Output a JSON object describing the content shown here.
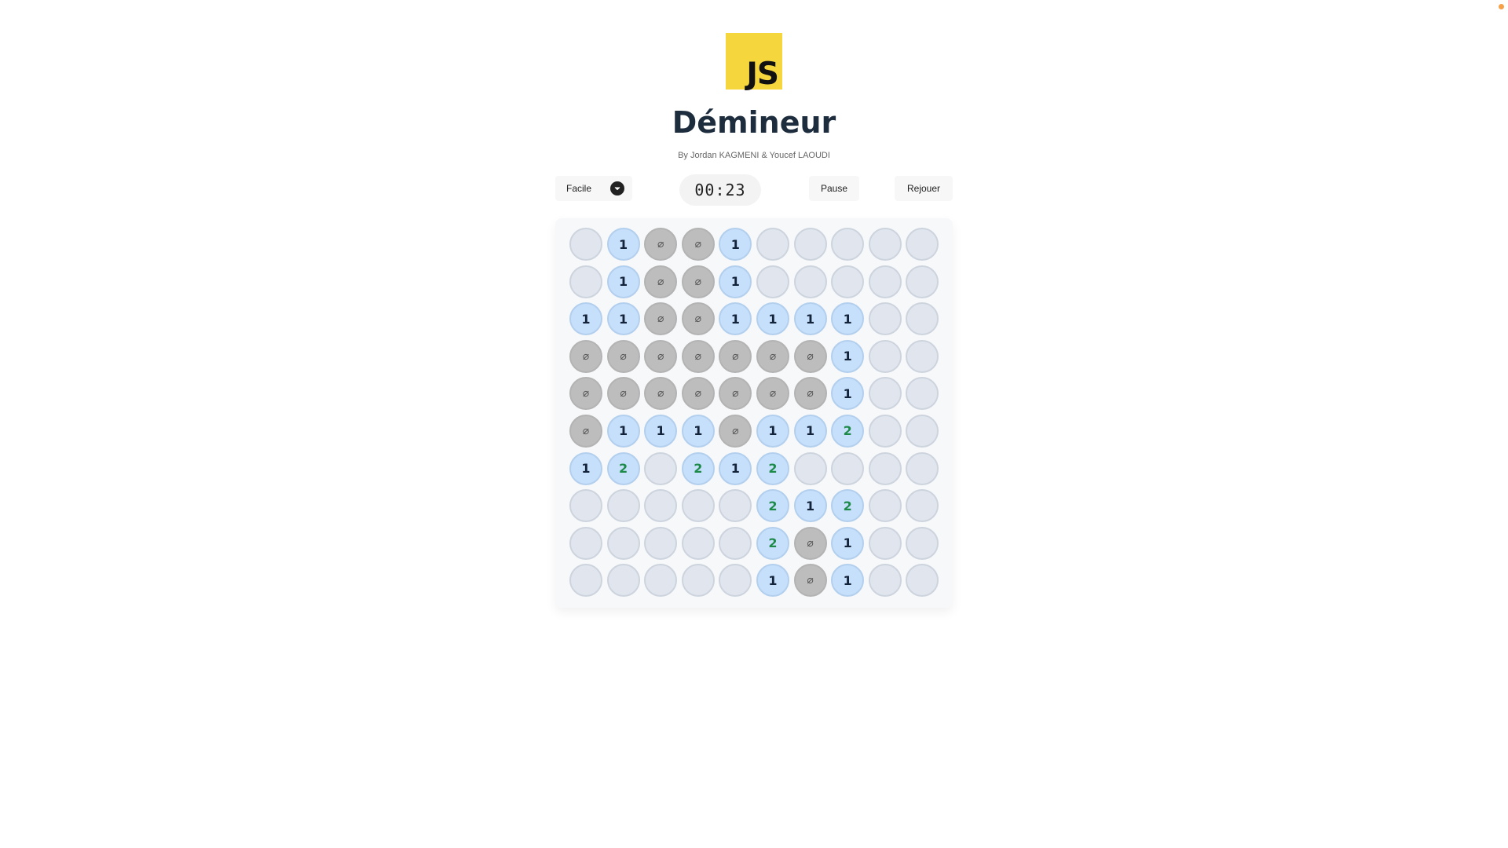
{
  "header": {
    "logo_text": "JS",
    "title": "Démineur",
    "subtitle": "By Jordan KAGMENI & Youcef LAOUDI"
  },
  "toolbar": {
    "difficulty_label": "Facile",
    "timer": "00:23",
    "pause_label": "Pause",
    "replay_label": "Rejouer"
  },
  "board": {
    "empty_symbol": "⌀",
    "rows": [
      [
        "H",
        "1",
        "E",
        "E",
        "1",
        "H",
        "H",
        "H",
        "H",
        "H"
      ],
      [
        "H",
        "1",
        "E",
        "E",
        "1",
        "H",
        "H",
        "H",
        "H",
        "H"
      ],
      [
        "1",
        "1",
        "E",
        "E",
        "1",
        "1",
        "1",
        "1",
        "H",
        "H"
      ],
      [
        "E",
        "E",
        "E",
        "E",
        "E",
        "E",
        "E",
        "1",
        "H",
        "H"
      ],
      [
        "E",
        "E",
        "E",
        "E",
        "E",
        "E",
        "E",
        "1",
        "H",
        "H"
      ],
      [
        "E",
        "1",
        "1",
        "1",
        "E",
        "1",
        "1",
        "2",
        "H",
        "H"
      ],
      [
        "1",
        "2",
        "H",
        "2",
        "1",
        "2",
        "H",
        "H",
        "H",
        "H"
      ],
      [
        "H",
        "H",
        "H",
        "H",
        "H",
        "2",
        "1",
        "2",
        "H",
        "H"
      ],
      [
        "H",
        "H",
        "H",
        "H",
        "H",
        "2",
        "E",
        "1",
        "H",
        "H"
      ],
      [
        "H",
        "H",
        "H",
        "H",
        "H",
        "1",
        "E",
        "1",
        "H",
        "H"
      ]
    ]
  },
  "colors": {
    "logo_bg": "#f5d63d",
    "hidden_cell": "#e1e6ee",
    "number_cell": "#c6dffb",
    "empty_cell": "#bdbdbd",
    "number_1": "#13233a",
    "number_2": "#1d8a4a"
  },
  "icons": {
    "difficulty_toggle": "chevron-down-icon",
    "logo": "js-logo-icon"
  }
}
